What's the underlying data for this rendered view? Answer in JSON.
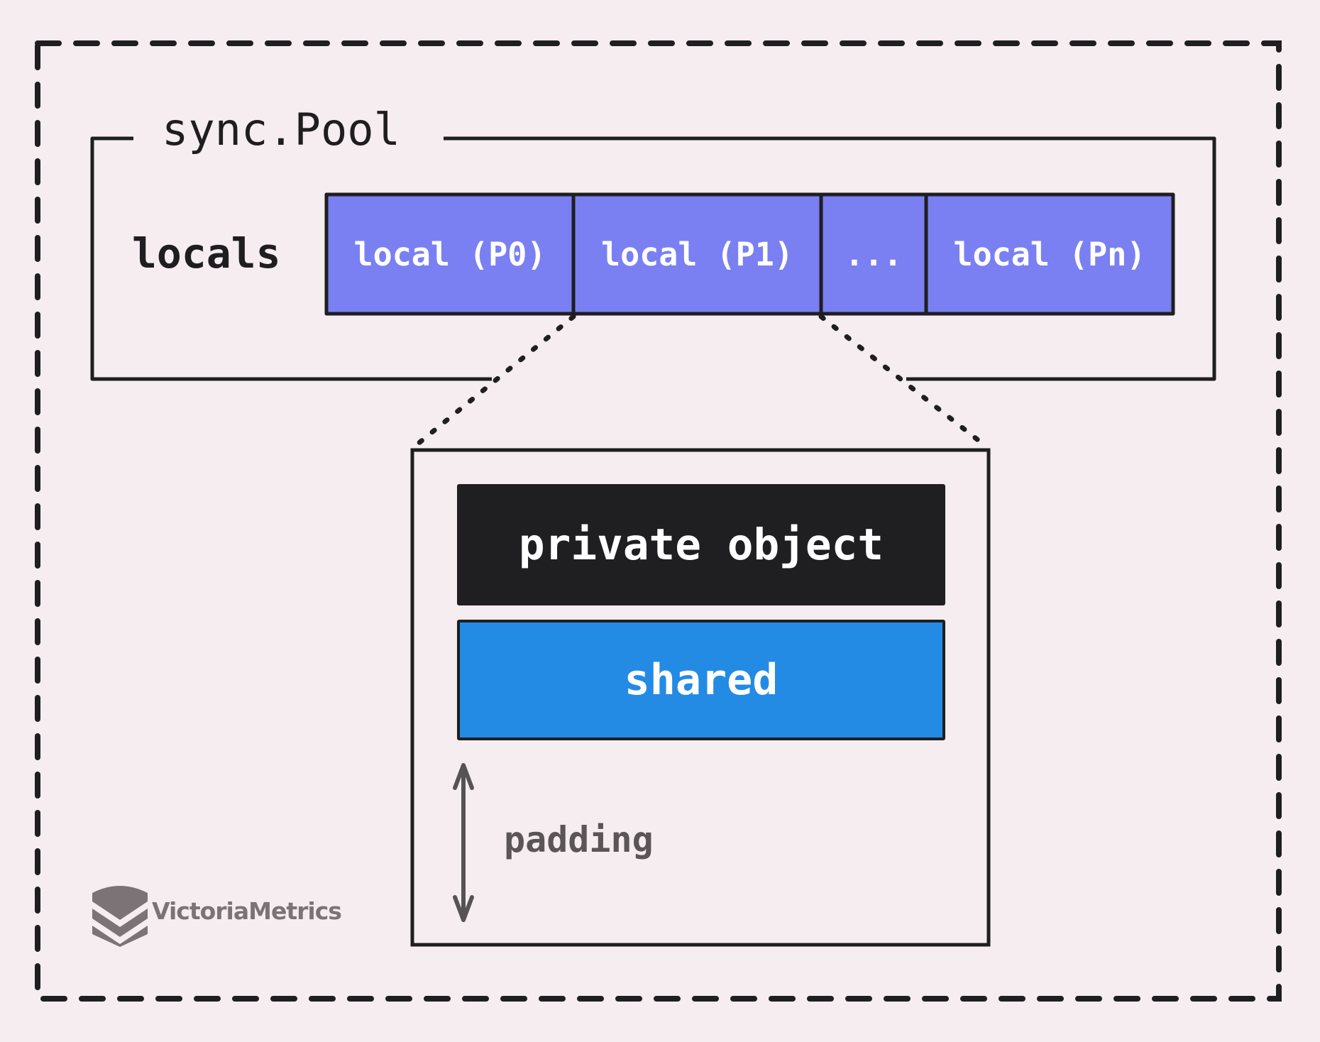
{
  "diagram": {
    "pool_title": "sync.Pool",
    "locals_label": "locals",
    "locals_cells": [
      {
        "label": "local (P0)"
      },
      {
        "label": "local (P1)"
      },
      {
        "label": "..."
      },
      {
        "label": "local (Pn)"
      }
    ],
    "expanded_cell": "local (P1)",
    "poolLocal": {
      "private_label": "private object",
      "shared_label": "shared",
      "padding_label": "padding"
    },
    "colors": {
      "background": "#F5EDF0",
      "stroke": "#1F1E20",
      "local_cell": "#7A80F2",
      "private": "#1F1E20",
      "shared": "#238BE4",
      "padding_arrow": "#575253",
      "logo": "#7B7376"
    }
  },
  "branding": {
    "logo_icon": "victoriametrics-logo-icon",
    "logo_text": "VictoriaMetrics"
  }
}
